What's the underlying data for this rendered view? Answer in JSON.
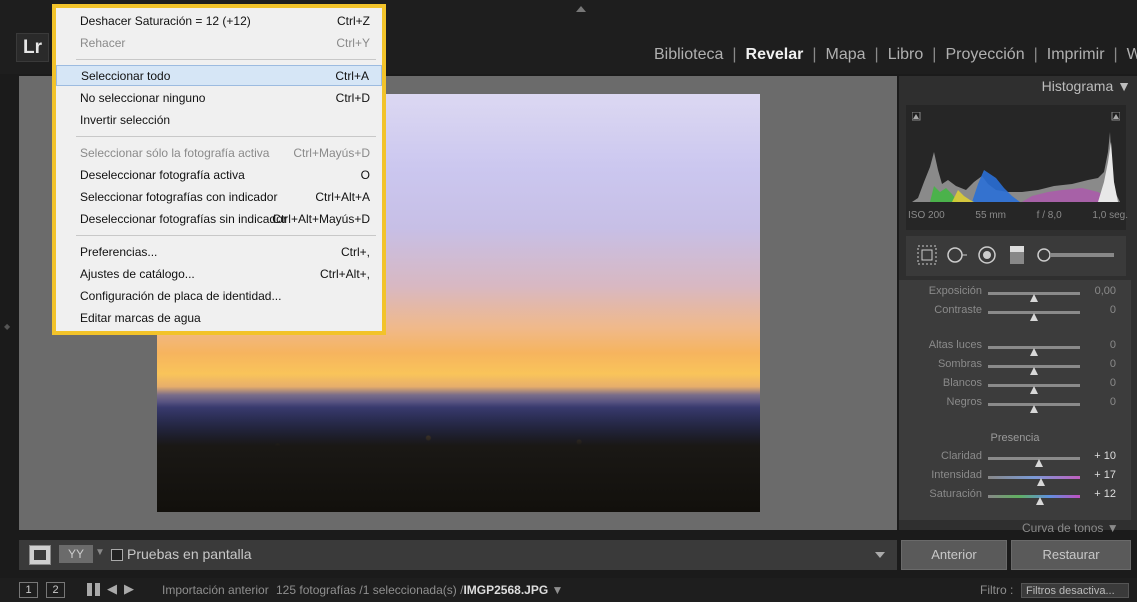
{
  "app": {
    "logo": "Lr"
  },
  "modules": [
    {
      "label": "Biblioteca",
      "active": false
    },
    {
      "label": "Revelar",
      "active": true
    },
    {
      "label": "Mapa",
      "active": false
    },
    {
      "label": "Libro",
      "active": false
    },
    {
      "label": "Proyección",
      "active": false
    },
    {
      "label": "Imprimir",
      "active": false
    },
    {
      "label": "We",
      "active": false
    }
  ],
  "menu": {
    "items": [
      {
        "label": "Deshacer Saturación = 12 (+12)",
        "shortcut": "Ctrl+Z",
        "disabled": false
      },
      {
        "label": "Rehacer",
        "shortcut": "Ctrl+Y",
        "disabled": true
      },
      {
        "label": "Seleccionar todo",
        "shortcut": "Ctrl+A",
        "disabled": false,
        "highlighted": true
      },
      {
        "label": "No seleccionar ninguno",
        "shortcut": "Ctrl+D",
        "disabled": false
      },
      {
        "label": "Invertir selección",
        "shortcut": "",
        "disabled": false
      },
      {
        "label": "Seleccionar sólo la fotografía activa",
        "shortcut": "Ctrl+Mayús+D",
        "disabled": true
      },
      {
        "label": "Deseleccionar fotografía activa",
        "shortcut": "O",
        "disabled": false
      },
      {
        "label": "Seleccionar fotografías con indicador",
        "shortcut": "Ctrl+Alt+A",
        "disabled": false
      },
      {
        "label": "Deseleccionar fotografías sin indicador",
        "shortcut": "Ctrl+Alt+Mayús+D",
        "disabled": false
      },
      {
        "label": "Preferencias...",
        "shortcut": "Ctrl+,",
        "disabled": false
      },
      {
        "label": "Ajustes de catálogo...",
        "shortcut": "Ctrl+Alt+,",
        "disabled": false
      },
      {
        "label": "Configuración de placa de identidad...",
        "shortcut": "",
        "disabled": false
      },
      {
        "label": "Editar marcas de agua",
        "shortcut": "",
        "disabled": false
      }
    ]
  },
  "toolbar": {
    "view_yy": "YY",
    "soft_proof_label": "Pruebas en pantalla"
  },
  "histogram": {
    "title": "Histograma",
    "iso": "ISO 200",
    "focal": "55 mm",
    "aperture": "f / 8,0",
    "shutter": "1,0 seg."
  },
  "basic": {
    "exposure": {
      "label": "Exposición",
      "value": "0,00",
      "level": 0.5
    },
    "contrast": {
      "label": "Contraste",
      "value": "0",
      "level": 0.5
    },
    "highlights": {
      "label": "Altas luces",
      "value": "0",
      "level": 0.5
    },
    "shadows": {
      "label": "Sombras",
      "value": "0",
      "level": 0.5
    },
    "whites": {
      "label": "Blancos",
      "value": "0",
      "level": 0.5
    },
    "blacks": {
      "label": "Negros",
      "value": "0",
      "level": 0.5
    },
    "presence_title": "Presencia",
    "clarity": {
      "label": "Claridad",
      "value": "+ 10",
      "level": 0.55
    },
    "vibrance": {
      "label": "Intensidad",
      "value": "+ 17",
      "level": 0.58
    },
    "saturation": {
      "label": "Saturación",
      "value": "+ 12",
      "level": 0.56
    }
  },
  "tone_curve_title": "Curva de tonos",
  "buttons": {
    "previous": "Anterior",
    "reset": "Restaurar"
  },
  "filmstrip": {
    "view1": "1",
    "view2": "2",
    "source": "Importación anterior",
    "count": "125 fotografías /1 seleccionada(s) /",
    "filename": "IMGP2568.JPG",
    "filter_label": "Filtro :",
    "filter_value": "Filtros desactiva..."
  }
}
